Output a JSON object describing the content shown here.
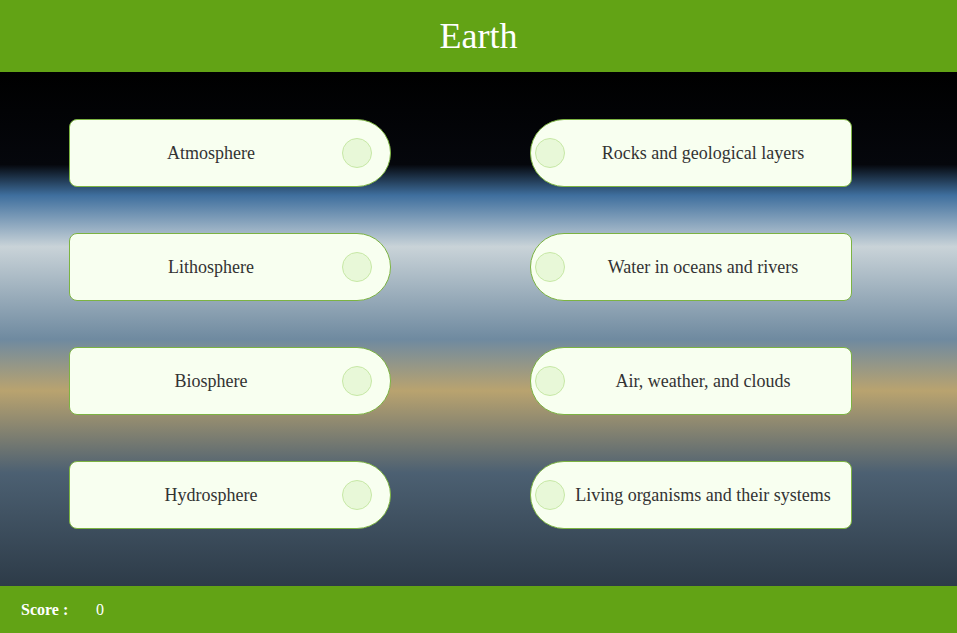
{
  "header": {
    "title": "Earth"
  },
  "terms": [
    {
      "label": "Atmosphere"
    },
    {
      "label": "Lithosphere"
    },
    {
      "label": "Biosphere"
    },
    {
      "label": "Hydrosphere"
    }
  ],
  "definitions": [
    {
      "label": "Rocks and geological layers"
    },
    {
      "label": "Water in oceans and rivers"
    },
    {
      "label": "Air, weather, and clouds"
    },
    {
      "label": "Living organisms and their systems"
    }
  ],
  "footer": {
    "score_label": "Score :",
    "score": "0"
  }
}
